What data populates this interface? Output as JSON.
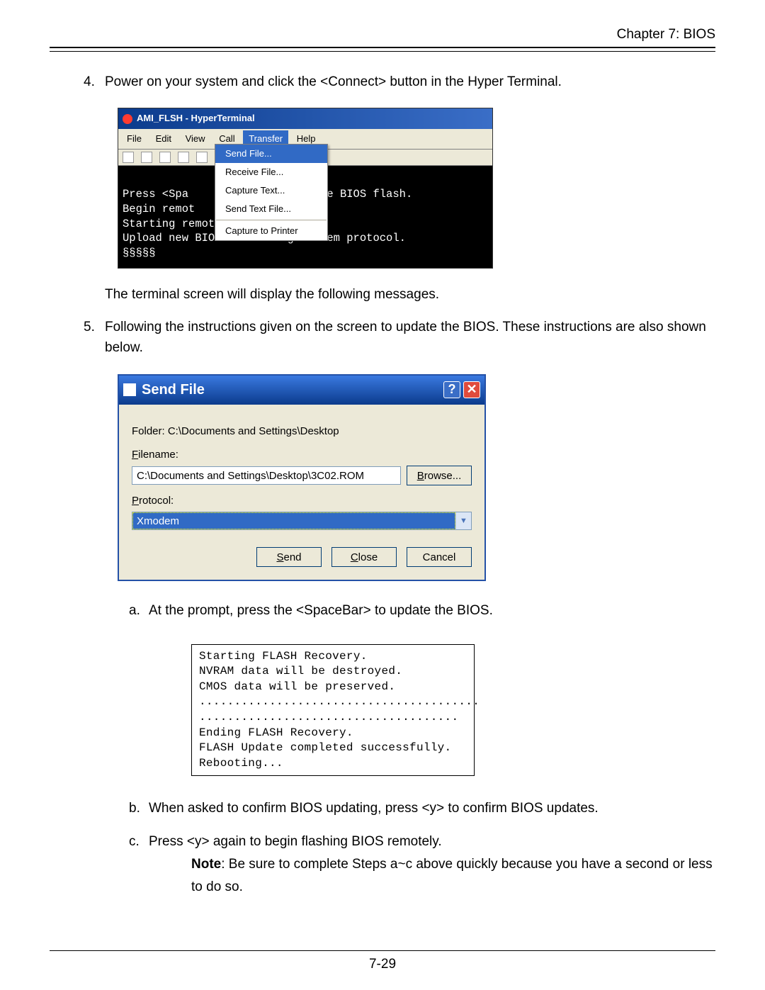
{
  "header": {
    "chapter": "Chapter 7: BIOS"
  },
  "steps": {
    "s4": {
      "num": "4.",
      "text": "Power on your system and click the <Connect> button in the Hyper Terminal.",
      "after": "The terminal screen will display the following messages."
    },
    "s5": {
      "num": "5.",
      "text": "Following the instructions given on the screen to update the BIOS. These instructions are also shown below."
    }
  },
  "ht": {
    "title": "AMI_FLSH - HyperTerminal",
    "menus": [
      "File",
      "Edit",
      "View",
      "Call",
      "Transfer",
      "Help"
    ],
    "selected_menu_index": 4,
    "dropdown": [
      {
        "label": "Send File...",
        "selected": true
      },
      {
        "label": "Receive File...",
        "selected": false
      },
      {
        "label": "Capture Text...",
        "selected": false
      },
      {
        "label": "Send Text File...",
        "selected": false
      },
      {
        "label": "---"
      },
      {
        "label": "Capture to Printer",
        "selected": false
      }
    ],
    "terminal_lines": [
      "Press <Spa            oke remote BIOS flash.",
      "Begin remot           ? (y/n) y",
      "Starting remote flash.",
      "Upload new BIOS file using Xmodem protocol.",
      "§§§§§"
    ]
  },
  "sf": {
    "title": "Send File",
    "folder_label": "Folder:  C:\\Documents and Settings\\Desktop",
    "filename_label_hot": "F",
    "filename_label_rest": "ilename:",
    "filename_value": "C:\\Documents and Settings\\Desktop\\3C02.ROM",
    "browse_hot": "B",
    "browse_rest": "rowse...",
    "protocol_label_hot": "P",
    "protocol_label_rest": "rotocol:",
    "protocol_value": "Xmodem",
    "send_hot": "S",
    "send_rest": "end",
    "close_hot": "C",
    "close_rest": "lose",
    "cancel": "Cancel"
  },
  "sub": {
    "a": {
      "letter": "a.",
      "text": "At the prompt, press the <SpaceBar> to update the BIOS."
    },
    "b": {
      "letter": "b.",
      "text": "When asked to confirm BIOS updating, press <y> to confirm BIOS updates."
    },
    "c": {
      "letter": "c.",
      "text": "Press <y> again to begin flashing BIOS remotely."
    }
  },
  "flash_box_lines": [
    "Starting FLASH Recovery.",
    "NVRAM data will be destroyed.",
    "CMOS data will be preserved.",
    "........................................",
    ".....................................",
    "Ending FLASH Recovery.",
    "FLASH Update completed successfully.",
    "Rebooting..."
  ],
  "note": {
    "label": "Note",
    "text": ": Be sure to complete Steps a~c above quickly because you have a second or less to do so."
  },
  "page_num": "7-29"
}
